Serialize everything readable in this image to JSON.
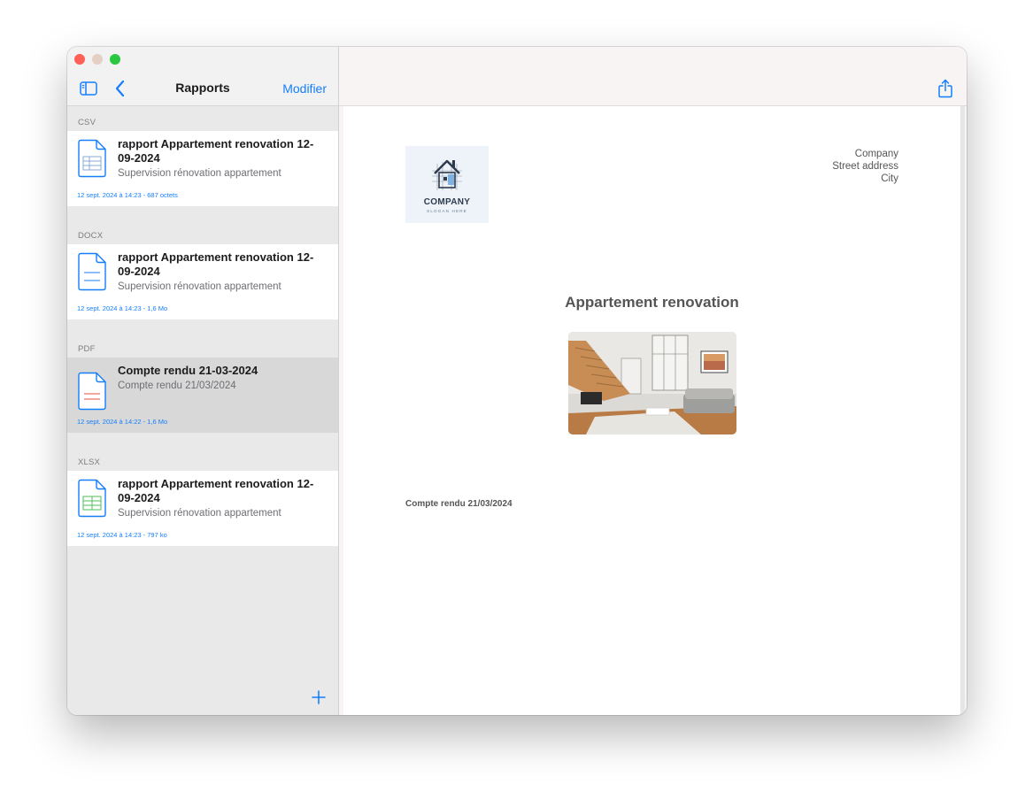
{
  "sidebar": {
    "title": "Rapports",
    "edit_label": "Modifier",
    "sections": [
      {
        "header": "CSV",
        "items": [
          {
            "title": "rapport Appartement renovation 12-09-2024",
            "subtitle": "Supervision rénovation appartement",
            "meta": "12 sept. 2024 à 14:23 - 687 octets",
            "icon": "csv-file-icon"
          }
        ]
      },
      {
        "header": "DOCX",
        "items": [
          {
            "title": "rapport Appartement renovation 12-09-2024",
            "subtitle": "Supervision rénovation appartement",
            "meta": "12 sept. 2024 à 14:23 - 1,6 Mo",
            "icon": "docx-file-icon"
          }
        ]
      },
      {
        "header": "PDF",
        "items": [
          {
            "title": "Compte rendu 21-03-2024",
            "subtitle": "Compte rendu 21/03/2024",
            "meta": "12 sept. 2024 à 14:22 - 1,6 Mo",
            "icon": "pdf-file-icon",
            "selected": true
          }
        ]
      },
      {
        "header": "XLSX",
        "items": [
          {
            "title": "rapport Appartement renovation 12-09-2024",
            "subtitle": "Supervision rénovation appartement",
            "meta": "12 sept. 2024 à 14:23 - 797 ko",
            "icon": "xlsx-file-icon"
          }
        ]
      }
    ]
  },
  "document": {
    "logo_word": "COMPANY",
    "logo_slogan": "SLOGAN HERE",
    "address_lines": [
      "Company",
      "Street address",
      "City"
    ],
    "title": "Appartement renovation",
    "note": "Compte rendu 21/03/2024"
  },
  "colors": {
    "accent": "#147efb",
    "csv_lines": "#8aa9d6",
    "pdf_lines": "#e0503c",
    "xlsx_lines": "#4cbf5a"
  }
}
